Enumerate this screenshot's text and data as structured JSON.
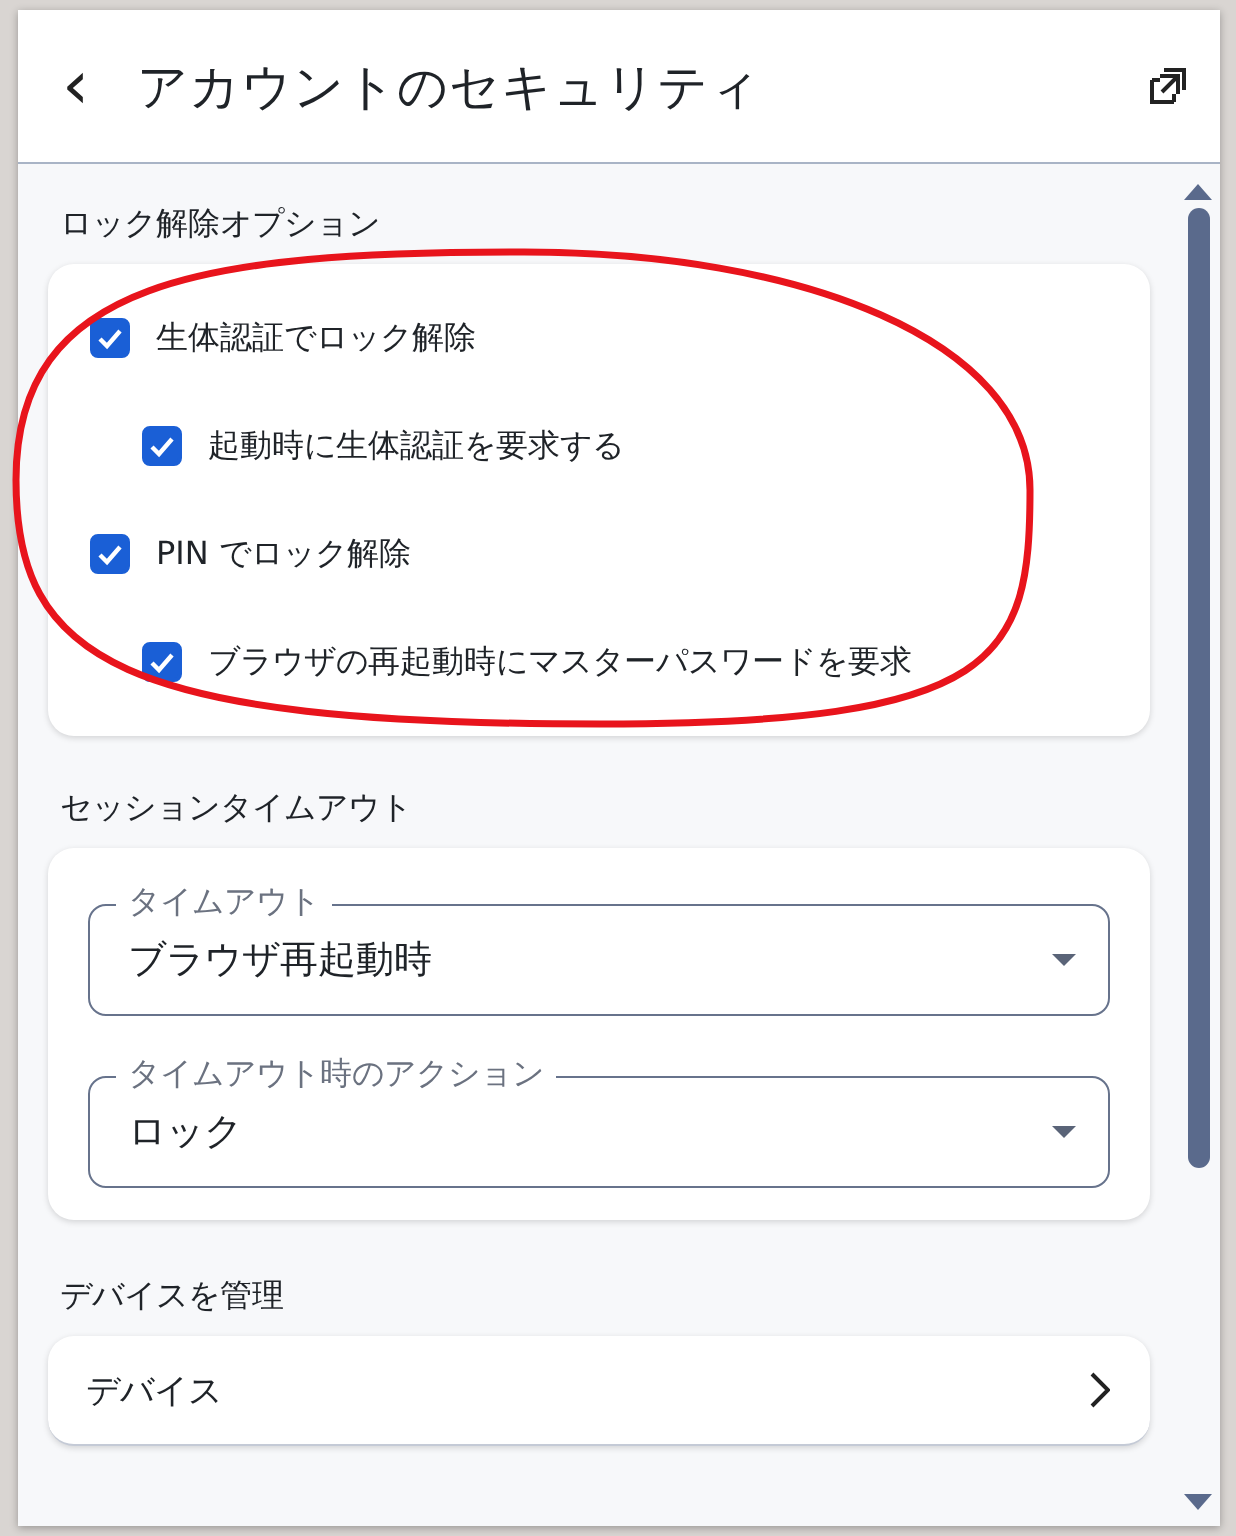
{
  "header": {
    "back": "‹",
    "title": "アカウントのセキュリティ"
  },
  "unlock": {
    "heading": "ロック解除オプション",
    "options": [
      {
        "label": "生体認証でロック解除",
        "checked": true,
        "children": [
          {
            "label": "起動時に生体認証を要求する",
            "checked": true
          }
        ]
      },
      {
        "label": "PIN でロック解除",
        "checked": true,
        "children": [
          {
            "label": "ブラウザの再起動時にマスターパスワードを要求",
            "checked": true
          }
        ]
      }
    ]
  },
  "session": {
    "heading": "セッションタイムアウト",
    "selects": [
      {
        "label": "タイムアウト",
        "value": "ブラウザ再起動時"
      },
      {
        "label": "タイムアウト時のアクション",
        "value": "ロック"
      }
    ]
  },
  "devices": {
    "heading": "デバイスを管理",
    "items": [
      {
        "label": "デバイス"
      }
    ]
  }
}
